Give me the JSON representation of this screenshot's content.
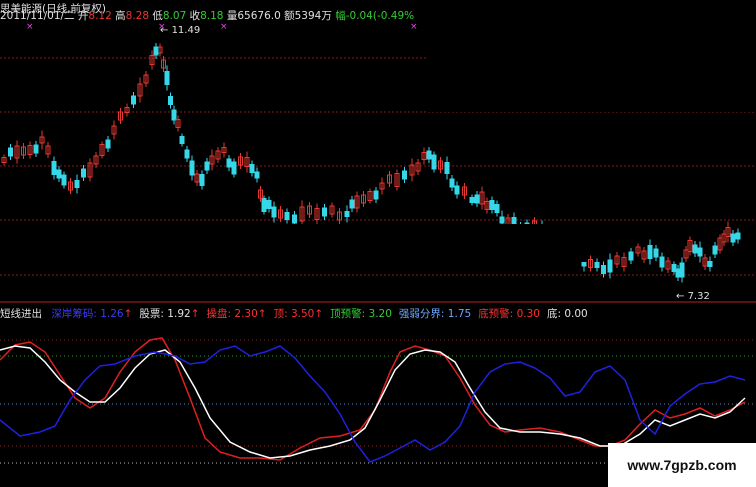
{
  "header": {
    "title": "思美能源(日线,前复权)",
    "date": "2011/11/01/二",
    "open_label": "开",
    "open": "8.12",
    "high_label": "高",
    "high": "8.28",
    "low_label": "低",
    "low": "8.07",
    "close_label": "收",
    "close": "8.18",
    "volume_label": "量",
    "volume": "65676.0",
    "amount_label": "额",
    "amount": "5394万",
    "change_label": "幅",
    "change": "-0.04(-0.49%"
  },
  "price_chart": {
    "high_marker": "11.49",
    "low_marker": "7.32",
    "up_color": "#e53935",
    "down_color": "#36d7e8"
  },
  "indicator": {
    "name": "短线进出",
    "items": [
      {
        "label": "深岸筹码",
        "value": "1.26",
        "arrow": "↑",
        "color": "#3a3aff"
      },
      {
        "label": "股票",
        "value": "1.92",
        "arrow": "↑",
        "color": "#e0e0e0"
      },
      {
        "label": "操盘",
        "value": "2.30",
        "arrow": "↑",
        "color": "#ff3030"
      },
      {
        "label": "顶",
        "value": "3.50",
        "arrow": "↑",
        "color": "#ff3030"
      },
      {
        "label": "顶预警",
        "value": "3.20",
        "arrow": "",
        "color": "#33cc33"
      },
      {
        "label": "强弱分界",
        "value": "1.75",
        "arrow": "",
        "color": "#6fa8ff"
      },
      {
        "label": "底预警",
        "value": "0.30",
        "arrow": "",
        "color": "#ff3030"
      },
      {
        "label": "底",
        "value": "0.00",
        "arrow": "",
        "color": "#e0e0e0"
      }
    ]
  },
  "watermark": "www.7gpzb.com",
  "colors": {
    "background": "#000000",
    "grid": "#8b1a1a",
    "white_line": "#ffffff",
    "red_line": "#e02020",
    "blue_line": "#2020e0"
  }
}
